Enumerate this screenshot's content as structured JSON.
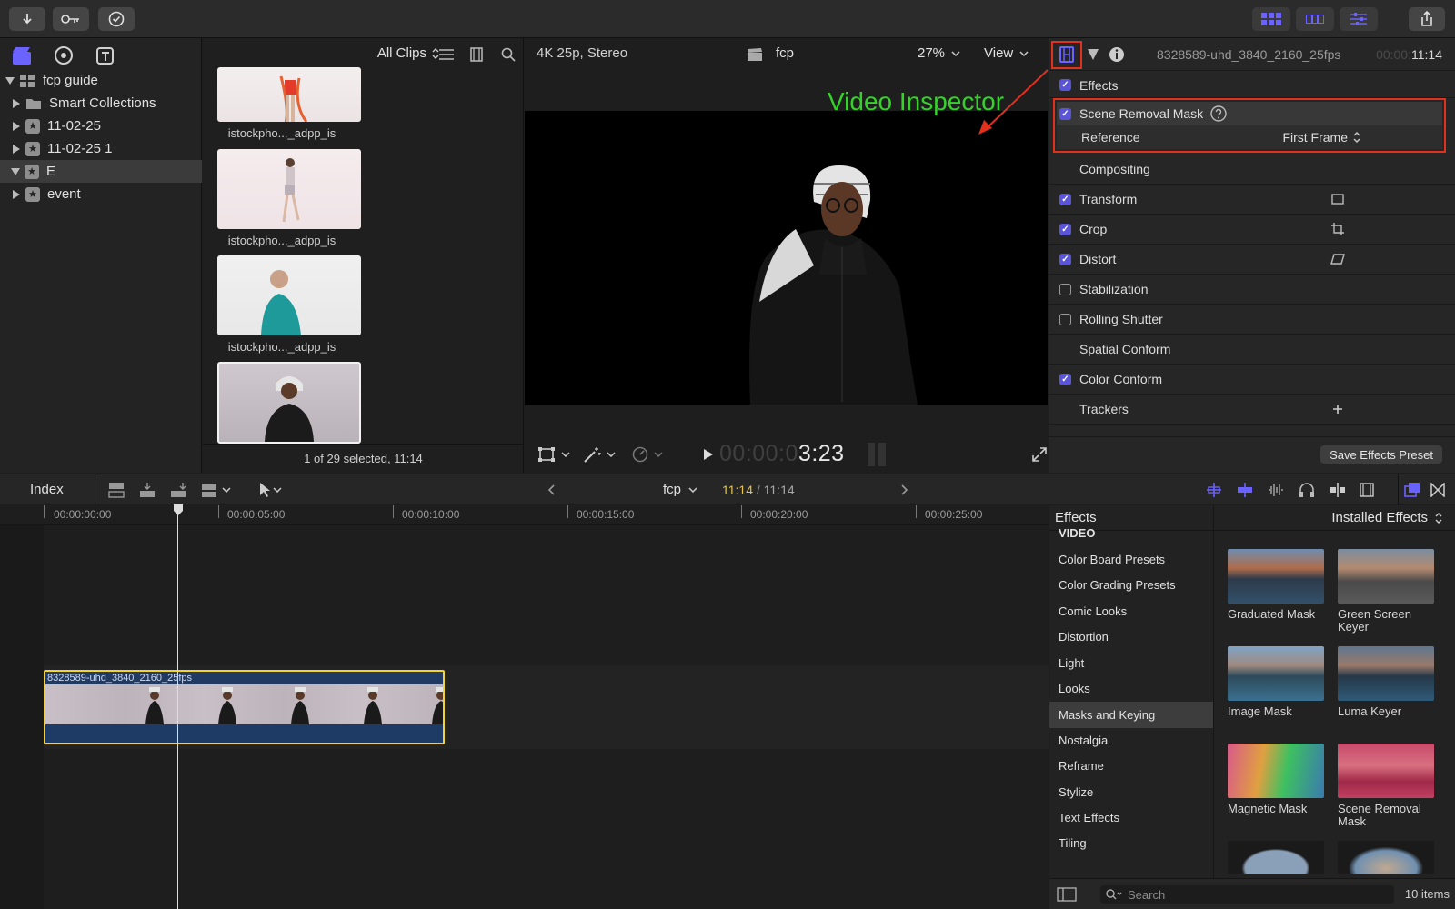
{
  "toolbar": {
    "icons": [
      "import-arrow-icon",
      "key-icon",
      "checkmark-circle-icon",
      "grid-icon",
      "filmstrip-icon",
      "sliders-icon",
      "share-icon"
    ]
  },
  "libraries": {
    "root": "fcp guide",
    "items": [
      {
        "label": "Smart Collections"
      },
      {
        "label": "11-02-25"
      },
      {
        "label": "11-02-25 1"
      },
      {
        "label": "E"
      },
      {
        "label": "event"
      }
    ]
  },
  "browser": {
    "filter": "All Clips",
    "thumbs": [
      "istockpho..._adpp_is",
      "istockpho..._adpp_is",
      "istockpho..._adpp_is"
    ],
    "status": "1 of 29 selected, 11:14"
  },
  "viewer": {
    "format": "4K 25p, Stereo",
    "project": "fcp",
    "zoom": "27%",
    "view_label": "View",
    "timecode_dim": "00:00:0",
    "timecode": "3:23",
    "annotation": "Video Inspector"
  },
  "inspector": {
    "clip_name": "8328589-uhd_3840_2160_25fps",
    "duration_dim": "00:00:",
    "duration": "11:14",
    "effects_label": "Effects",
    "scene_removal": "Scene Removal Mask",
    "reference_label": "Reference",
    "reference_value": "First Frame",
    "rows": [
      {
        "label": "Compositing",
        "check": "none"
      },
      {
        "label": "Transform",
        "check": "on"
      },
      {
        "label": "Crop",
        "check": "on"
      },
      {
        "label": "Distort",
        "check": "on"
      },
      {
        "label": "Stabilization",
        "check": "off"
      },
      {
        "label": "Rolling Shutter",
        "check": "off"
      },
      {
        "label": "Spatial Conform",
        "check": "none"
      },
      {
        "label": "Color Conform",
        "check": "on"
      },
      {
        "label": "Trackers",
        "check": "none"
      }
    ],
    "save_preset": "Save Effects Preset"
  },
  "timeline_bar": {
    "index": "Index",
    "project": "fcp",
    "position": "11:14",
    "separator": "/",
    "total": "11:14"
  },
  "ruler": [
    "00:00:00:00",
    "00:00:05:00",
    "00:00:10:00",
    "00:00:15:00",
    "00:00:20:00",
    "00:00:25:00"
  ],
  "clip": {
    "name": "8328589-uhd_3840_2160_25fps"
  },
  "effects_browser": {
    "header": "Effects",
    "installed": "Installed Effects",
    "categories": [
      "VIDEO",
      "Color Board Presets",
      "Color Grading Presets",
      "Comic Looks",
      "Distortion",
      "Light",
      "Looks",
      "Masks and Keying",
      "Nostalgia",
      "Reframe",
      "Stylize",
      "Text Effects",
      "Tiling"
    ],
    "selected_category": "Masks and Keying",
    "items": [
      "Graduated Mask",
      "Green Screen Keyer",
      "Image Mask",
      "Luma Keyer",
      "Magnetic Mask",
      "Scene Removal Mask"
    ],
    "search_placeholder": "Search",
    "count": "10 items"
  },
  "colors": {
    "accent": "#5a54d6",
    "highlight_red": "#e0301e",
    "clip_yellow": "#f2d335",
    "annotation_green": "#35d22a",
    "timecode_yellow": "#e6c44a"
  }
}
